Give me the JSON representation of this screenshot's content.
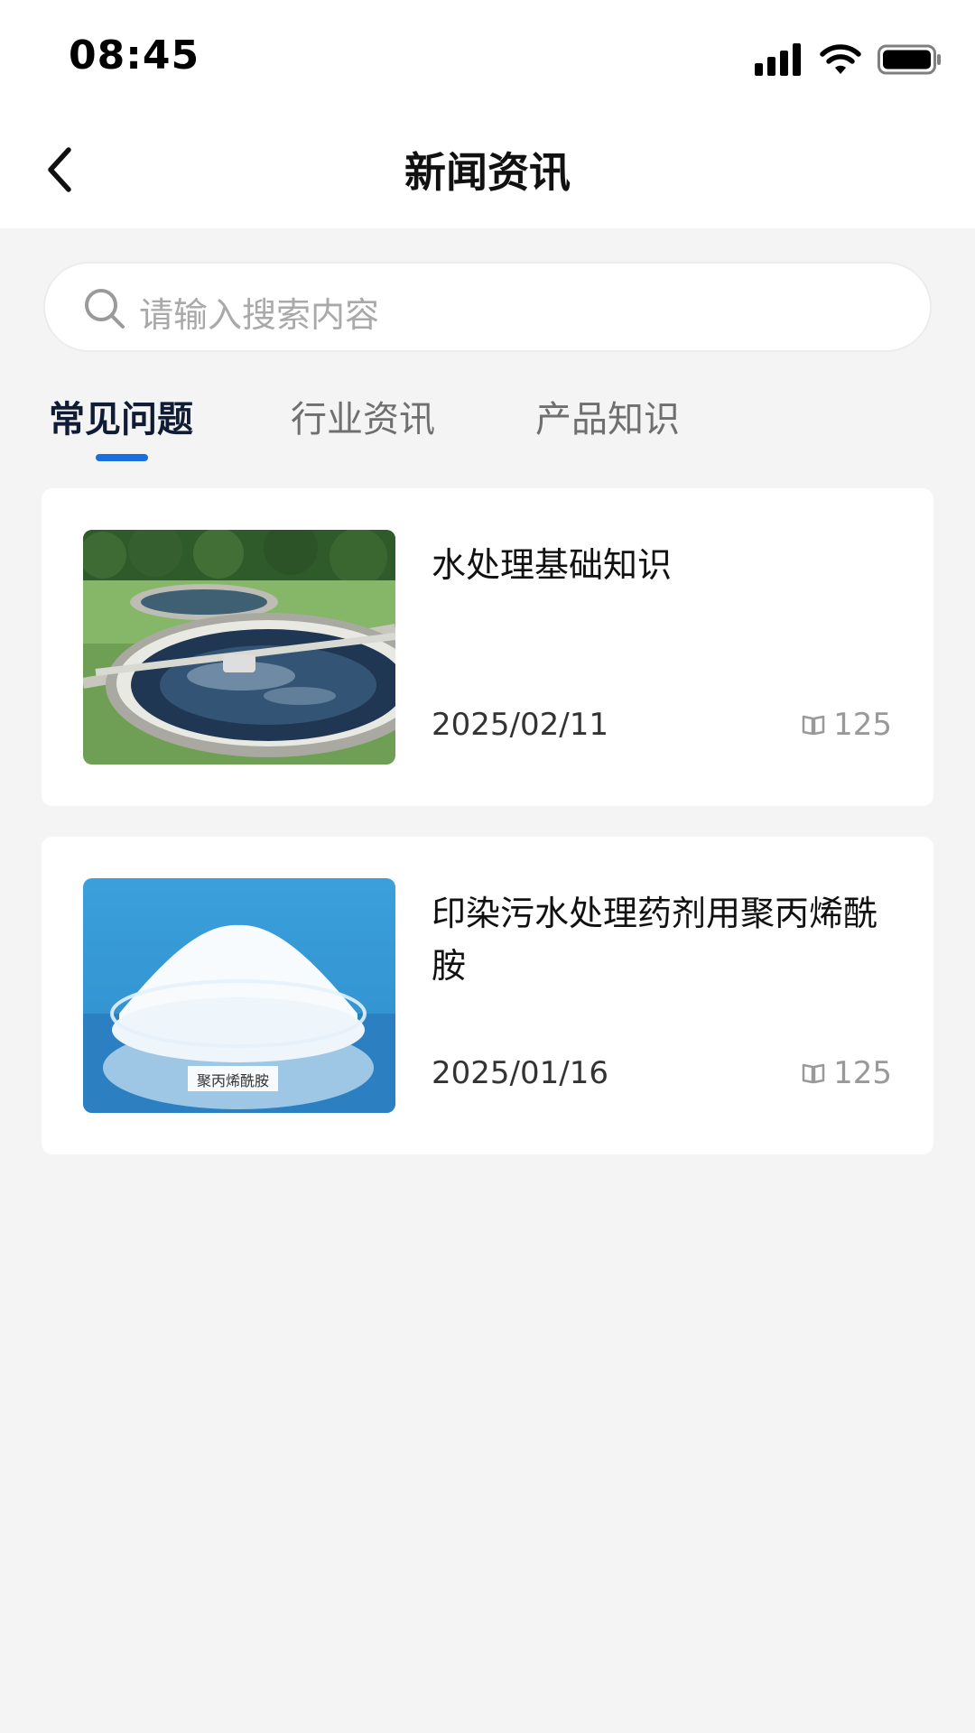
{
  "status_bar": {
    "time": "08:45"
  },
  "header": {
    "title": "新闻资讯"
  },
  "search": {
    "placeholder": "请输入搜索内容"
  },
  "tabs": [
    {
      "label": "常见问题",
      "active": true
    },
    {
      "label": "行业资讯",
      "active": false
    },
    {
      "label": "产品知识",
      "active": false
    }
  ],
  "articles": [
    {
      "title": "水处理基础知识",
      "date": "2025/02/11",
      "views": "125",
      "thumb_icon": "water-treatment-tank-image"
    },
    {
      "title": "印染污水处理药剂用聚丙烯酰胺",
      "date": "2025/01/16",
      "views": "125",
      "thumb_icon": "polyacrylamide-powder-image",
      "thumb_label": "聚丙烯酰胺"
    }
  ],
  "colors": {
    "accent": "#1a6fe0",
    "background": "#f4f4f4",
    "active_tab": "#0f1c33"
  }
}
